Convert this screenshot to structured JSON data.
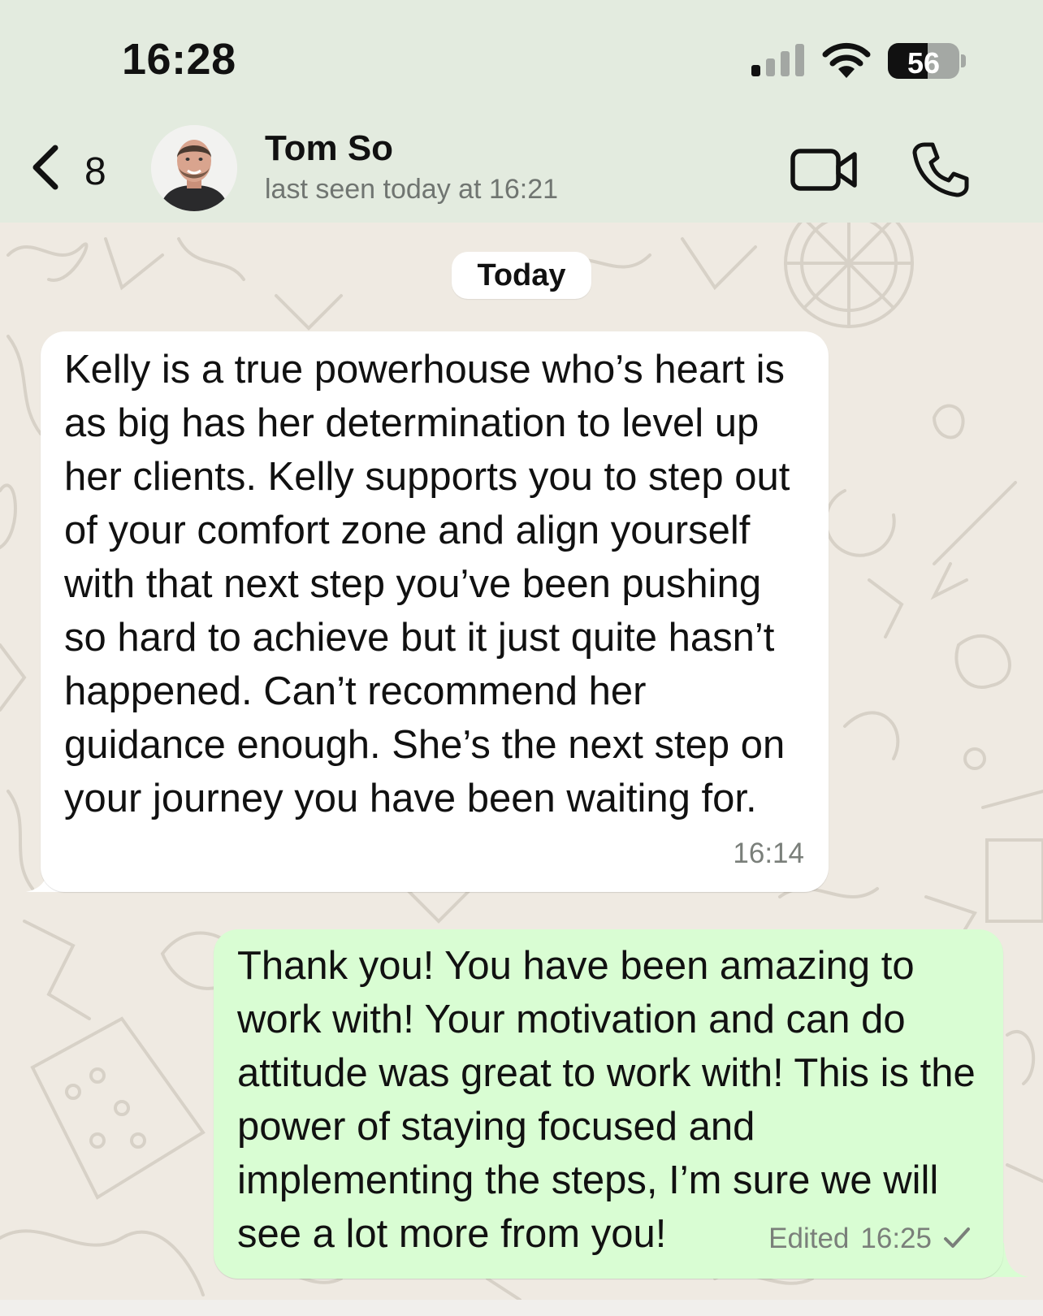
{
  "status_bar": {
    "time": "16:28",
    "battery_level": "56",
    "icons": [
      "cellular-signal-icon",
      "wifi-icon",
      "battery-icon"
    ]
  },
  "header": {
    "back_count": "8",
    "contact_name": "Tom So",
    "last_seen": "last seen today at 16:21",
    "icons": [
      "back-chevron-icon",
      "video-camera-icon",
      "phone-icon"
    ]
  },
  "chat": {
    "date_separator": "Today",
    "messages": [
      {
        "direction": "incoming",
        "text": "Kelly is a true powerhouse who’s heart is as big has her determination to level up her clients. Kelly supports you to step out of your comfort zone and align yourself with that next step you’ve been pushing so hard to achieve but it just quite hasn’t happened. Can’t recommend her guidance enough. She’s the next step on your journey you have been waiting for.",
        "time": "16:14"
      },
      {
        "direction": "outgoing",
        "text": "Thank you! You have been amazing to work with! Your motivation and can do attitude was great to work with! This is the power of staying focused and implementing the steps, I’m sure we will see a lot more from you!",
        "edited_label": "Edited",
        "time": "16:25",
        "status": "sent-check-icon"
      }
    ]
  },
  "colors": {
    "header_background": "#e3ebdf",
    "chat_background": "#efeae2",
    "incoming_bubble": "#ffffff",
    "outgoing_bubble": "#d9fdd3",
    "secondary_text": "#707571"
  }
}
